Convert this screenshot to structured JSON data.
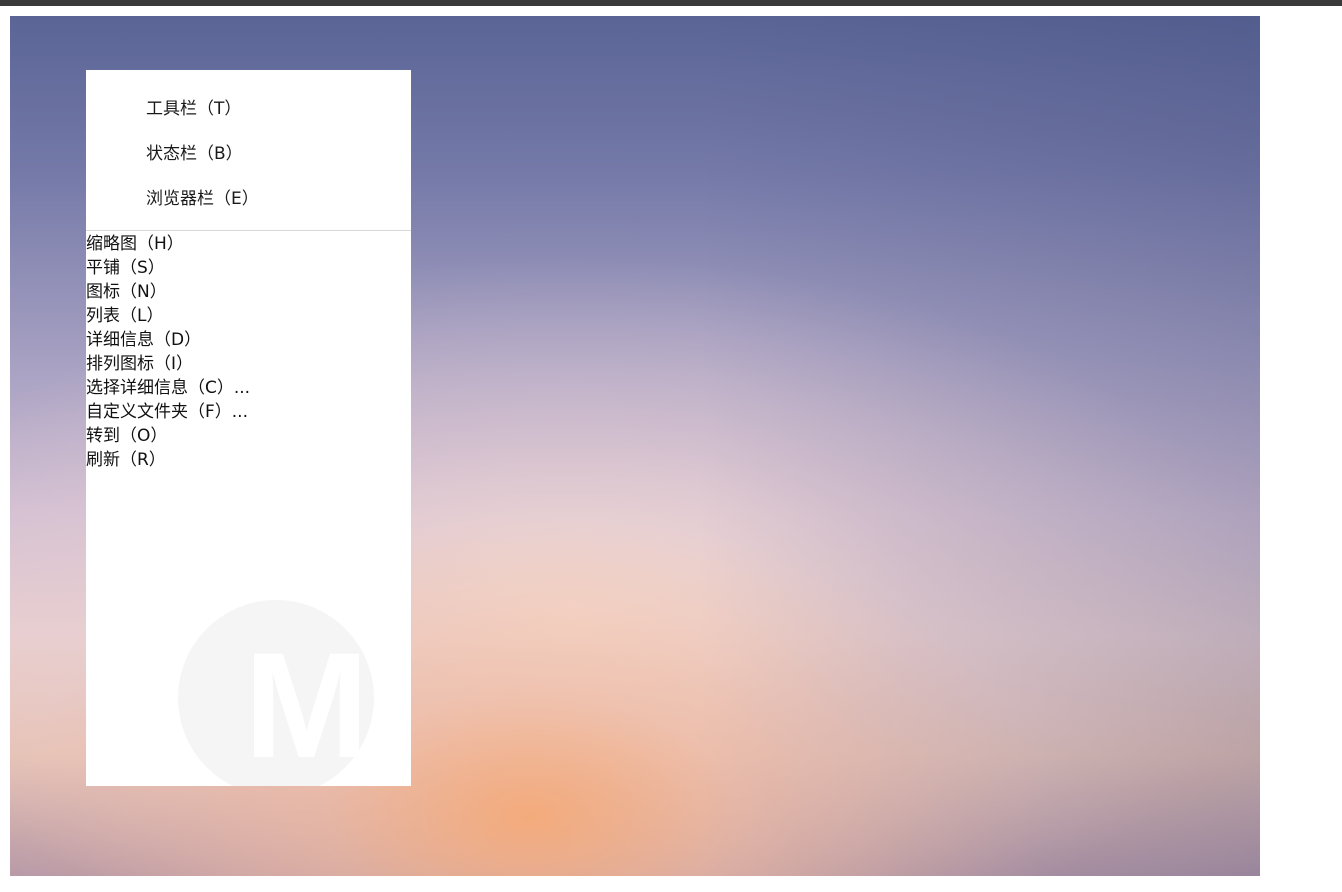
{
  "menu": {
    "top_items": [
      {
        "label": "工具栏（T）"
      },
      {
        "label": "状态栏（B）"
      },
      {
        "label": "浏览器栏（E）"
      }
    ],
    "items": [
      {
        "label": "缩略图（H）"
      },
      {
        "label": "平铺（S）"
      },
      {
        "label": "图标（N）"
      },
      {
        "label": "列表（L）"
      },
      {
        "label": "详细信息（D）"
      },
      {
        "label": "排列图标（I）"
      },
      {
        "label": "选择详细信息（C）..."
      },
      {
        "label": "自定义文件夹（F）..."
      },
      {
        "label": "转到（O）"
      },
      {
        "label": "刷新（R）"
      }
    ]
  },
  "watermark": {
    "text": "M"
  }
}
